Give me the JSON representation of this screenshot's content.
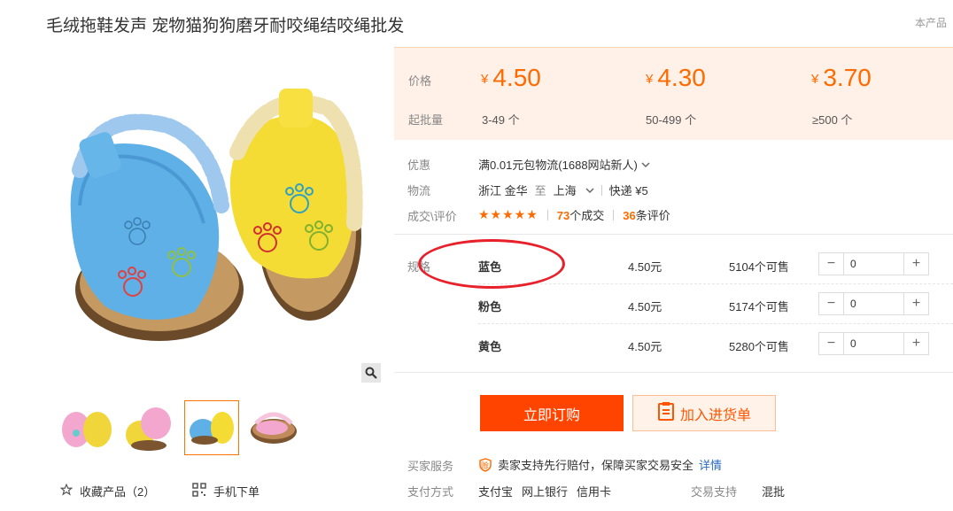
{
  "title": "毛绒拖鞋发声 宠物猫狗狗磨牙耐咬绳结咬绳批发",
  "notice": "本产品",
  "price_tiers": {
    "price_label": "价格",
    "moq_label": "起批量",
    "currency": "¥",
    "tiers": [
      {
        "price": "4.50",
        "moq": "3-49 个"
      },
      {
        "price": "4.30",
        "moq": "50-499 个"
      },
      {
        "price": "3.70",
        "moq": "≥500 个"
      }
    ]
  },
  "promo": {
    "label": "优惠",
    "text": "满0.01元包物流(1688网站新人)"
  },
  "logistics": {
    "label": "物流",
    "from": "浙江 金华",
    "to_word": "至",
    "to": "上海",
    "express": "快递 ¥5"
  },
  "reviews": {
    "label": "成交\\评价",
    "stars": "★★★★★",
    "deals_count": "73",
    "deals_text": "个成交",
    "reviews_count": "36",
    "reviews_text": "条评价"
  },
  "sku": {
    "label": "规格",
    "rows": [
      {
        "name": "蓝色",
        "price": "4.50元",
        "stock": "5104个可售",
        "qty": "0"
      },
      {
        "name": "粉色",
        "price": "4.50元",
        "stock": "5174个可售",
        "qty": "0"
      },
      {
        "name": "黄色",
        "price": "4.50元",
        "stock": "5280个可售",
        "qty": "0"
      }
    ]
  },
  "actions": {
    "buy": "立即订购",
    "cart": "加入进货单"
  },
  "service": {
    "label": "买家服务",
    "badge": "赊",
    "text": "卖家支持先行赔付，保障买家交易安全",
    "link": "详情"
  },
  "payment": {
    "label": "支付方式",
    "methods": [
      "支付宝",
      "网上银行",
      "信用卡"
    ],
    "trade_label": "交易支持",
    "trade_value": "混批"
  },
  "gallery": {
    "favorite": "收藏产品（2）",
    "mobile": "手机下单",
    "selected_thumb": 2
  },
  "colors": {
    "accent": "#ff6a00",
    "buy": "#ff4400",
    "price_bg": "#fff1e8",
    "annotation": "#e8202a"
  }
}
